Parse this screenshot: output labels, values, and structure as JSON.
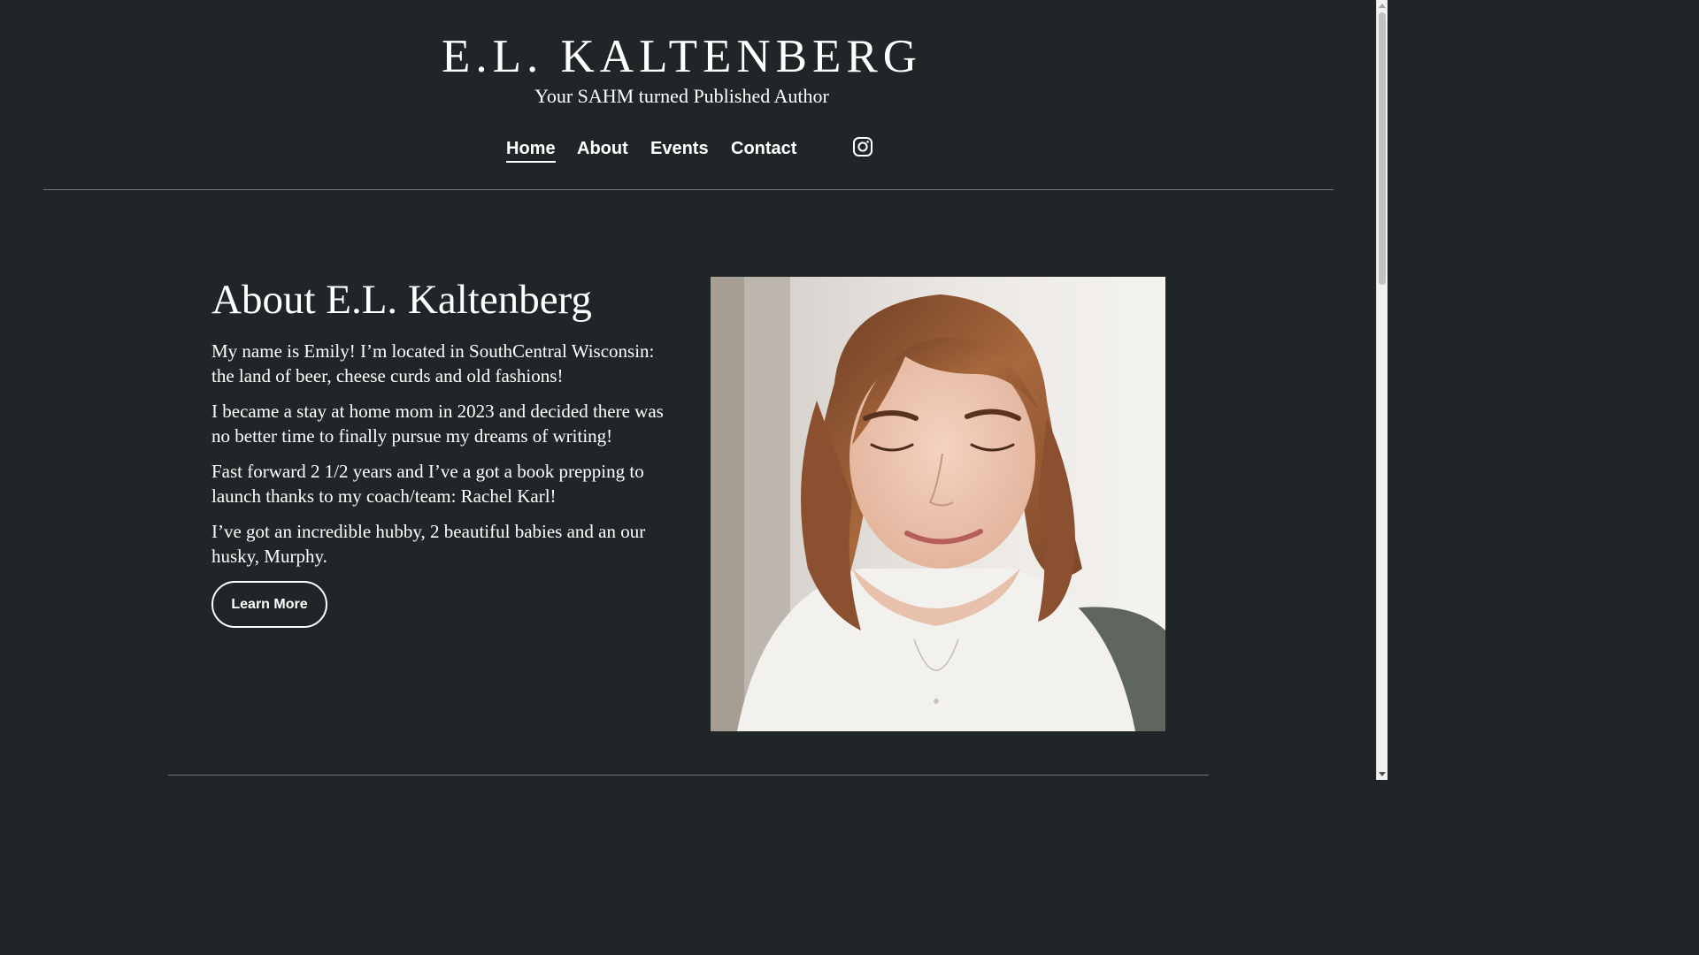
{
  "header": {
    "site_title": "E.L. KALTENBERG",
    "tagline": "Your SAHM turned Published Author"
  },
  "nav": {
    "items": [
      {
        "label": "Home",
        "active": true
      },
      {
        "label": "About",
        "active": false
      },
      {
        "label": "Events",
        "active": false
      },
      {
        "label": "Contact",
        "active": false
      }
    ],
    "social_icon": "instagram-icon"
  },
  "about": {
    "heading": "About E.L. Kaltenberg",
    "paragraphs": [
      "My name is Emily! I’m located in SouthCentral Wisconsin: the land of beer, cheese curds and old fashions!",
      "I became a stay at home mom in 2023 and decided there was no better time to finally pursue my dreams of writing!",
      "Fast forward 2 1/2 years and I’ve a got a book prepping to launch thanks to my coach/team: Rachel Karl!",
      "I’ve got an incredible hubby, 2 beautiful babies and an our husky, Murphy."
    ],
    "button_label": "Learn More"
  },
  "colors": {
    "background": "#202627",
    "text": "#ffffff",
    "divider": "#6f7677"
  }
}
